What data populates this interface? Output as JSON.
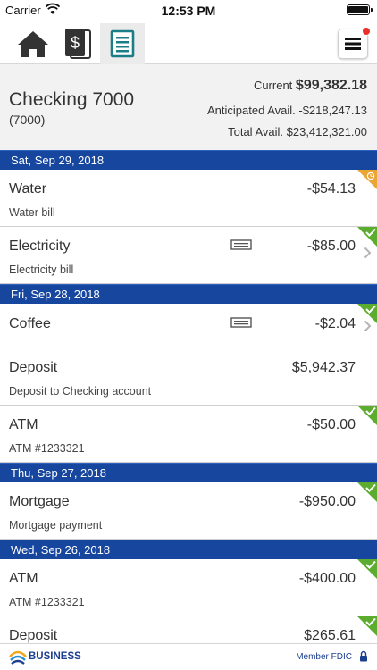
{
  "status_bar": {
    "carrier": "Carrier",
    "time": "12:53 PM"
  },
  "nav": {
    "tabs": [
      {
        "icon": "home-icon",
        "selected": false
      },
      {
        "icon": "bill-pay-icon",
        "selected": false
      },
      {
        "icon": "account-activity-icon",
        "selected": true
      }
    ],
    "menu_icon": "hamburger-menu-icon",
    "notification": true
  },
  "account": {
    "name": "Checking 7000",
    "number": "(7000)",
    "current_label": "Current",
    "current_amount": "$99,382.18",
    "anticipated_text": "Anticipated Avail. -$218,247.13",
    "total_text": "Total Avail. $23,412,321.00"
  },
  "groups": [
    {
      "date": "Sat, Sep 29, 2018",
      "transactions": [
        {
          "payee": "Water",
          "amount": "-$54.13",
          "memo": "Water bill",
          "status": "pending"
        },
        {
          "payee": "Electricity",
          "amount": "-$85.00",
          "memo": "Electricity bill",
          "status": "cleared",
          "check_image": true,
          "detail": true
        }
      ]
    },
    {
      "date": "Fri, Sep 28, 2018",
      "transactions": [
        {
          "payee": "Coffee",
          "amount": "-$2.04",
          "memo": "",
          "status": "cleared",
          "check_image": true,
          "detail": true
        },
        {
          "payee": "Deposit",
          "amount": "$5,942.37",
          "memo": "Deposit to Checking account",
          "status": "none"
        },
        {
          "payee": "ATM",
          "amount": "-$50.00",
          "memo": "ATM #1233321",
          "status": "cleared"
        }
      ]
    },
    {
      "date": "Thu, Sep 27, 2018",
      "transactions": [
        {
          "payee": "Mortgage",
          "amount": "-$950.00",
          "memo": "Mortgage payment",
          "status": "cleared"
        }
      ]
    },
    {
      "date": "Wed, Sep 26, 2018",
      "transactions": [
        {
          "payee": "ATM",
          "amount": "-$400.00",
          "memo": "ATM #1233321",
          "status": "cleared"
        },
        {
          "payee": "Deposit",
          "amount": "$265.61",
          "memo": "",
          "status": "cleared"
        }
      ]
    }
  ],
  "footer": {
    "brand": "BUSINESS",
    "fdic": "Member FDIC"
  },
  "colors": {
    "date_header": "#17469e",
    "cleared": "#5cad2f",
    "pending": "#eba533",
    "brand": "#1b3f8f"
  }
}
